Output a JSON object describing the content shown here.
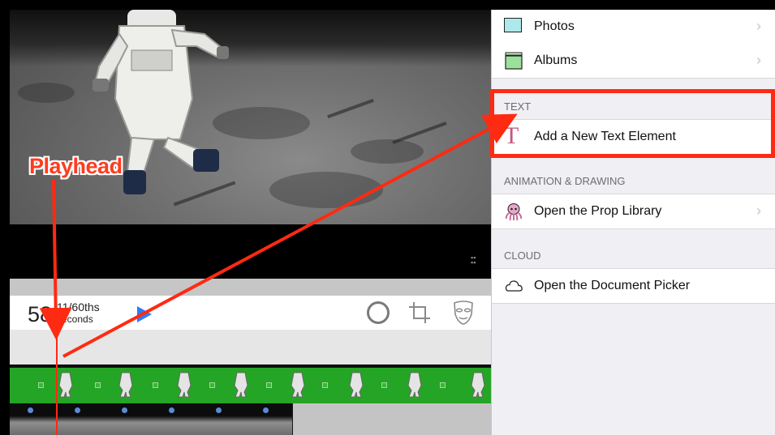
{
  "annotations": {
    "playhead_label": "Playhead",
    "arrow_color": "#ff2a12"
  },
  "editor": {
    "time": {
      "seconds": "58",
      "fraction": "11/60ths",
      "unit": "seconds"
    },
    "buttons": {
      "play": "play-icon",
      "shape": "circle-icon",
      "crop": "crop-icon",
      "mask": "mask-icon"
    },
    "track_color": "#25a525"
  },
  "panel": {
    "photos_label": "Photos",
    "albums_label": "Albums",
    "text_section": "TEXT",
    "add_text_label": "Add a New Text Element",
    "animation_section": "ANIMATION & DRAWING",
    "prop_library_label": "Open the Prop Library",
    "cloud_section": "CLOUD",
    "document_picker_label": "Open the Document Picker",
    "chevron": "›"
  }
}
